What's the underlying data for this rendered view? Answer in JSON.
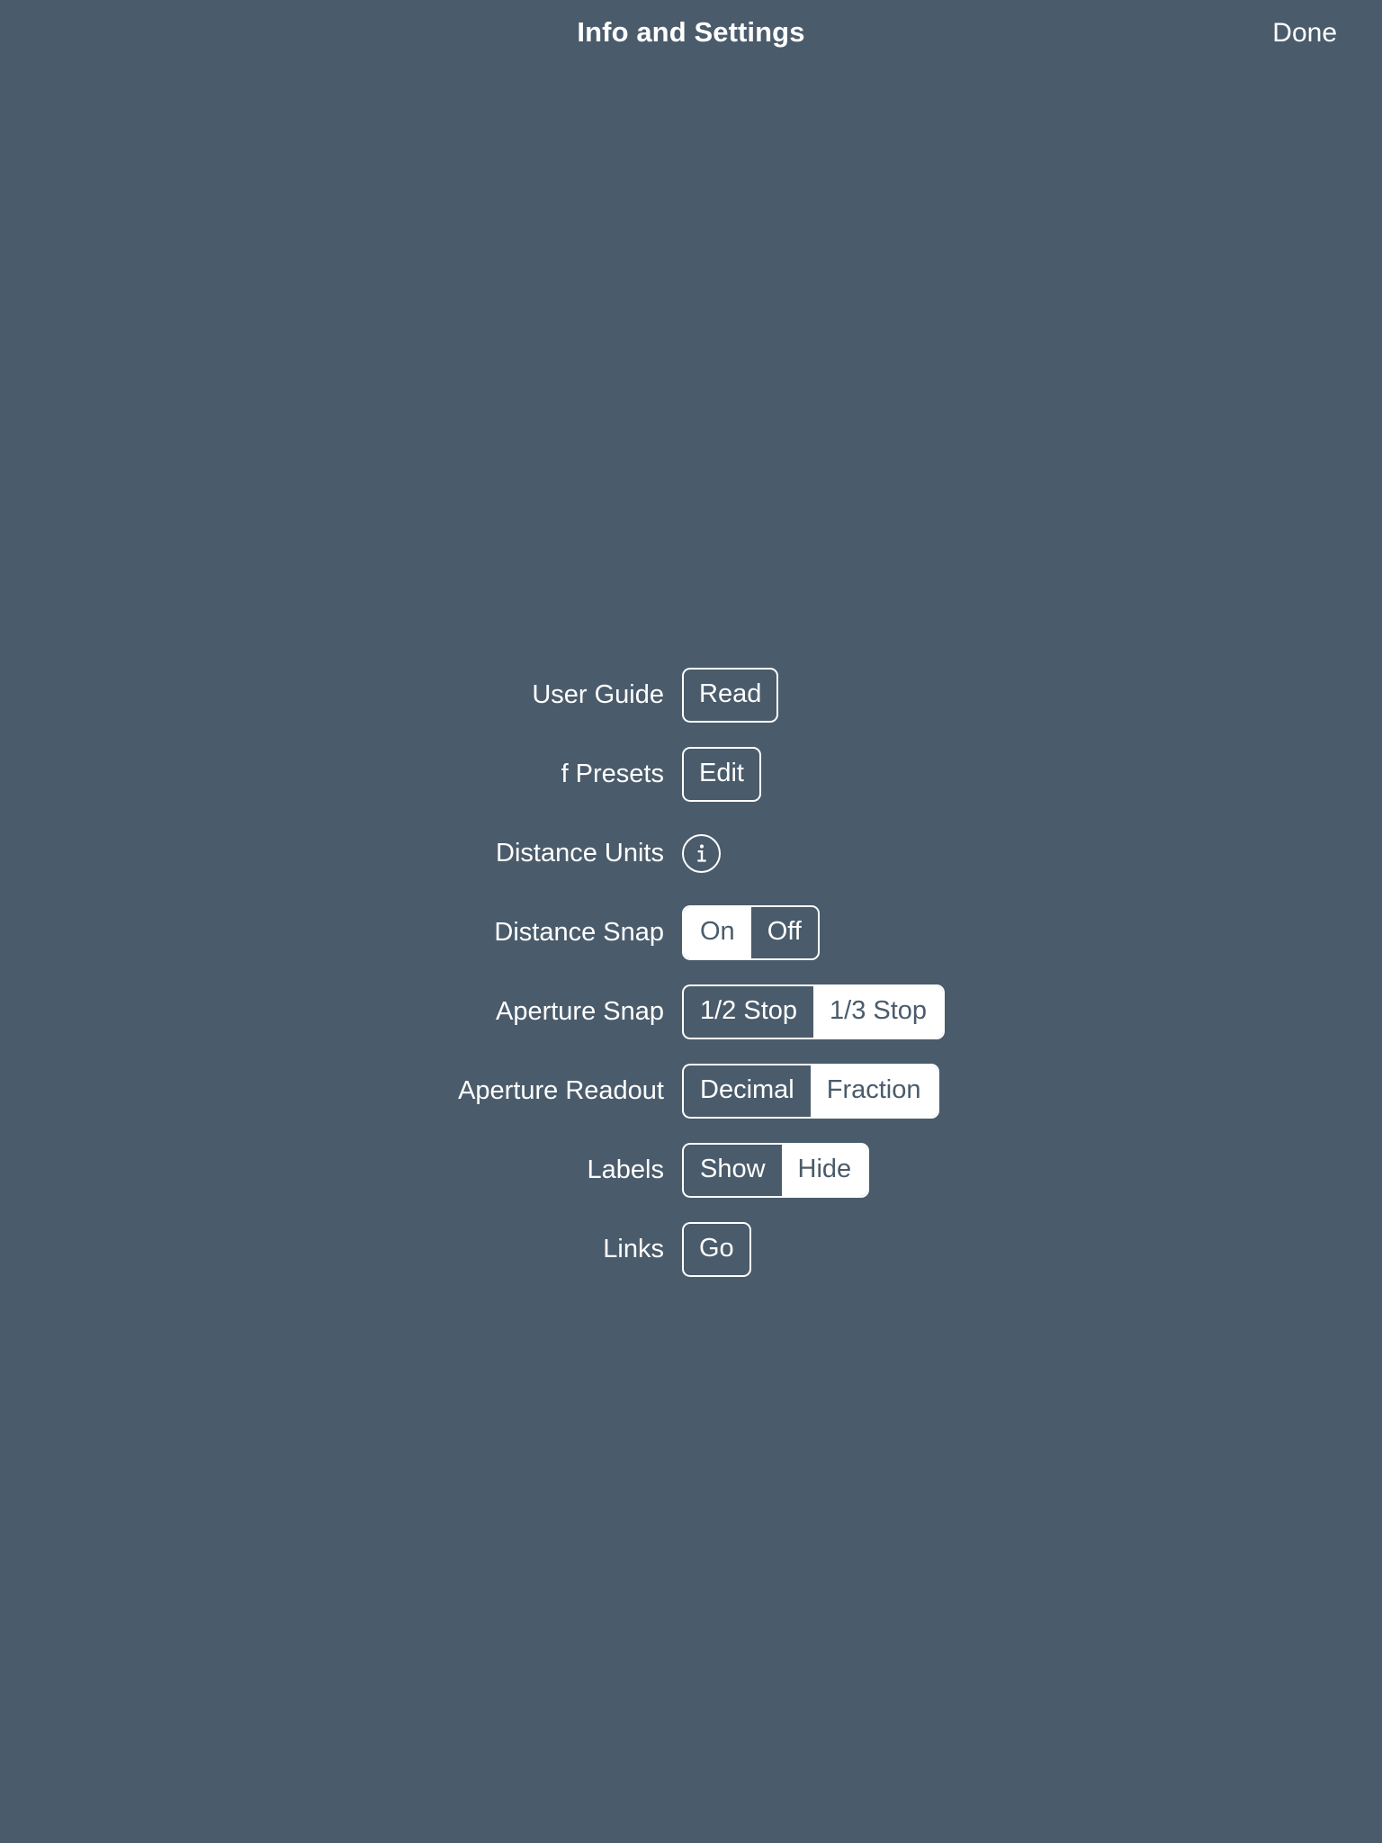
{
  "header": {
    "title": "Info and Settings",
    "done_label": "Done"
  },
  "theme": {
    "background": "#4a5b6b",
    "foreground": "#ffffff",
    "selected_text": "#4a5b6b"
  },
  "settings": {
    "rows": [
      {
        "id": "user-guide",
        "label": "User Guide",
        "control": "button",
        "button_label": "Read"
      },
      {
        "id": "f-presets",
        "label": "f Presets",
        "control": "button",
        "button_label": "Edit"
      },
      {
        "id": "distance-units",
        "label": "Distance Units",
        "control": "info-icon",
        "icon": "info-circle-icon"
      },
      {
        "id": "distance-snap",
        "label": "Distance Snap",
        "control": "segmented",
        "options": [
          "On",
          "Off"
        ],
        "selected": "On"
      },
      {
        "id": "aperture-snap",
        "label": "Aperture Snap",
        "control": "segmented",
        "options": [
          "1/2 Stop",
          "1/3 Stop"
        ],
        "selected": "1/3 Stop"
      },
      {
        "id": "aperture-readout",
        "label": "Aperture Readout",
        "control": "segmented",
        "options": [
          "Decimal",
          "Fraction"
        ],
        "selected": "Fraction"
      },
      {
        "id": "labels",
        "label": "Labels",
        "control": "segmented",
        "options": [
          "Show",
          "Hide"
        ],
        "selected": "Hide"
      },
      {
        "id": "links",
        "label": "Links",
        "control": "button",
        "button_label": "Go"
      }
    ]
  }
}
